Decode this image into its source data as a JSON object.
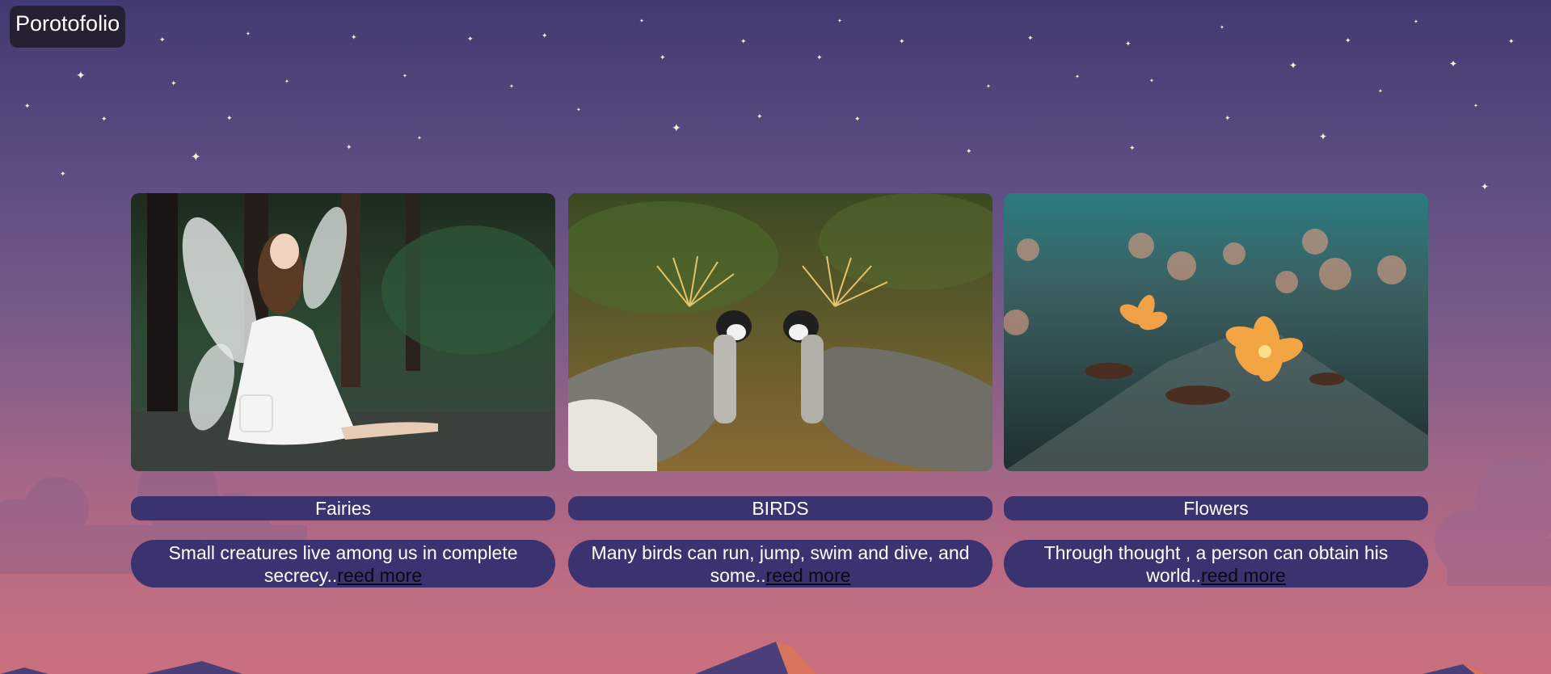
{
  "header": {
    "logo_text": "Porotofolio"
  },
  "cards": [
    {
      "title": "Fairies",
      "description": "Small creatures live among us in complete secrecy..",
      "link_label": "reed more",
      "image_subject": "fairy-in-forest"
    },
    {
      "title": "BIRDS",
      "description": "Many birds can run, jump, swim and dive, and some..",
      "link_label": "reed more",
      "image_subject": "crowned-cranes"
    },
    {
      "title": "Flowers",
      "description": "Through thought , a person can obtain his world..",
      "link_label": "reed more",
      "image_subject": "fallen-flowers"
    }
  ],
  "colors": {
    "card_background": "#3b336f",
    "logo_background": "#262035",
    "sky_top": "#413a71",
    "sky_bottom": "#c9707e",
    "star": "#f6efd8"
  }
}
